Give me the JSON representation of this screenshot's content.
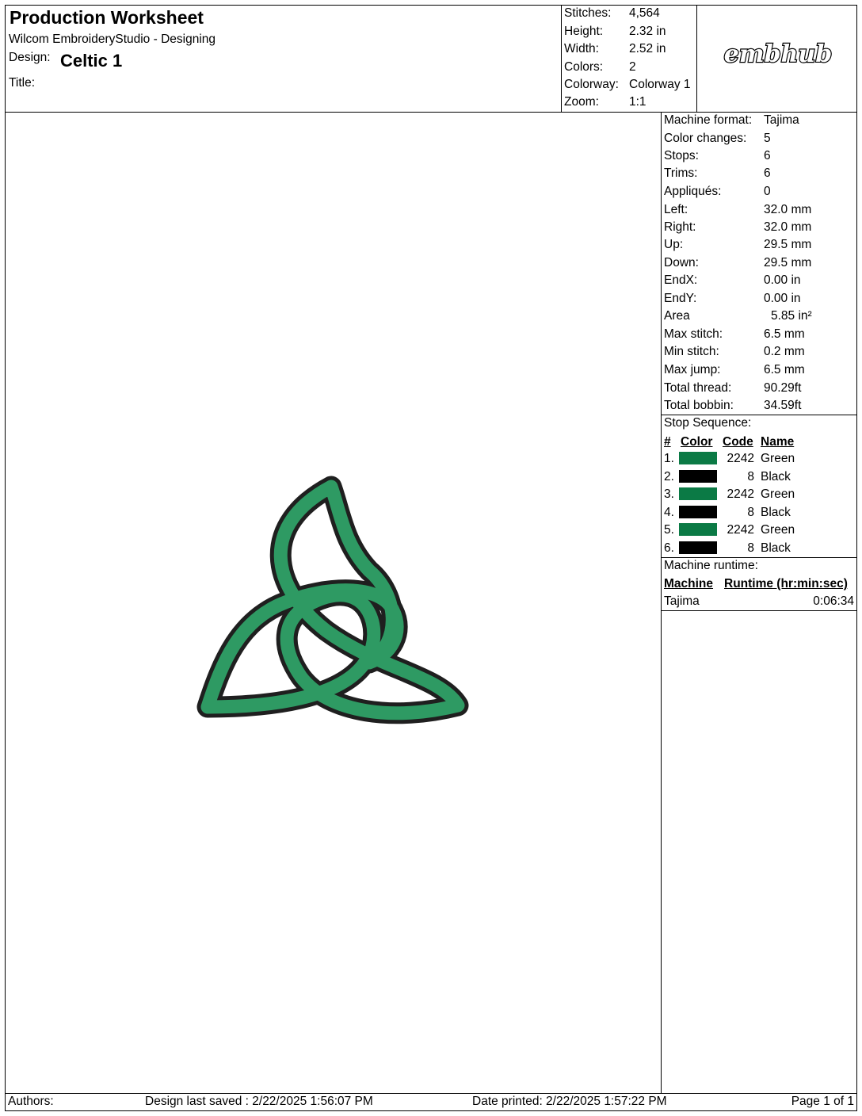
{
  "header": {
    "title": "Production Worksheet",
    "software": "Wilcom EmbroideryStudio - Designing",
    "design_label": "Design:",
    "design_name": "Celtic 1",
    "title_label": "Title:",
    "logo_text": "embhub"
  },
  "summary": [
    {
      "label": "Stitches:",
      "value": "4,564"
    },
    {
      "label": "Height:",
      "value": "2.32 in"
    },
    {
      "label": "Width:",
      "value": "2.52 in"
    },
    {
      "label": "Colors:",
      "value": "2"
    },
    {
      "label": "Colorway:",
      "value": "Colorway 1"
    },
    {
      "label": "Zoom:",
      "value": "1:1"
    }
  ],
  "machine_info": [
    {
      "label": "Machine format:",
      "value": "Tajima"
    },
    {
      "label": "Color changes:",
      "value": "5"
    },
    {
      "label": "Stops:",
      "value": "6"
    },
    {
      "label": "Trims:",
      "value": "6"
    },
    {
      "label": "Appliqués:",
      "value": "0"
    },
    {
      "label": "Left:",
      "value": "32.0 mm"
    },
    {
      "label": "Right:",
      "value": "32.0 mm"
    },
    {
      "label": "Up:",
      "value": "29.5 mm"
    },
    {
      "label": "Down:",
      "value": "29.5 mm"
    },
    {
      "label": "EndX:",
      "value": "0.00 in"
    },
    {
      "label": "EndY:",
      "value": "0.00 in"
    },
    {
      "label": "Area",
      "value": "5.85 in²"
    },
    {
      "label": "Max stitch:",
      "value": "6.5 mm"
    },
    {
      "label": "Min stitch:",
      "value": "0.2 mm"
    },
    {
      "label": "Max jump:",
      "value": "6.5 mm"
    },
    {
      "label": "Total thread:",
      "value": "90.29ft"
    },
    {
      "label": "Total bobbin:",
      "value": "34.59ft"
    }
  ],
  "stop_sequence": {
    "heading": "Stop Sequence:",
    "columns": [
      "#",
      "Color",
      "Code",
      "Name"
    ],
    "rows": [
      {
        "num": "1.",
        "color": "#0b7a45",
        "code": "2242",
        "name": "Green"
      },
      {
        "num": "2.",
        "color": "#000000",
        "code": "8",
        "name": "Black"
      },
      {
        "num": "3.",
        "color": "#0b7a45",
        "code": "2242",
        "name": "Green"
      },
      {
        "num": "4.",
        "color": "#000000",
        "code": "8",
        "name": "Black"
      },
      {
        "num": "5.",
        "color": "#0b7a45",
        "code": "2242",
        "name": "Green"
      },
      {
        "num": "6.",
        "color": "#000000",
        "code": "8",
        "name": "Black"
      }
    ]
  },
  "runtime": {
    "heading": "Machine runtime:",
    "columns": [
      "Machine",
      "Runtime (hr:min:sec)"
    ],
    "rows": [
      {
        "machine": "Tajima",
        "runtime": "0:06:34"
      }
    ]
  },
  "footer": {
    "authors": "Authors:",
    "saved": "Design last saved : 2/22/2025 1:56:07 PM",
    "printed": "Date printed: 2/22/2025 1:57:22 PM",
    "page": "Page 1 of 1"
  },
  "colors": {
    "green": "#2e9a63",
    "outline": "#2b2b2b"
  }
}
